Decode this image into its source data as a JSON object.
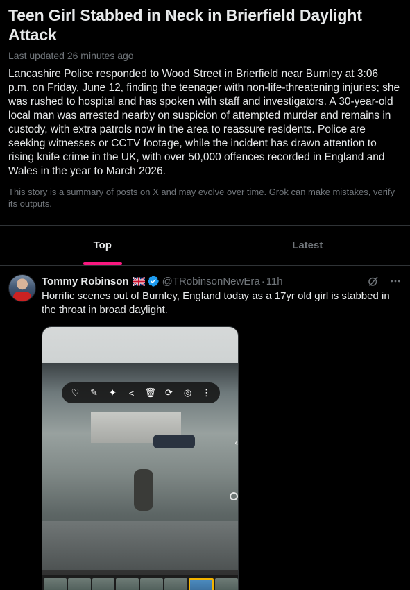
{
  "story": {
    "title": "Teen Girl Stabbed in Neck in Brierfield Daylight Attack",
    "updated": "Last updated 26 minutes ago",
    "summary": "Lancashire Police responded to Wood Street in Brierfield near Burnley at 3:06 p.m. on Friday, June 12, finding the teenager with non-life-threatening injuries; she was rushed to hospital and has spoken with staff and investigators. A 30-year-old local man was arrested nearby on suspicion of attempted murder and remains in custody, with extra patrols now in the area to reassure residents. Police are seeking witnesses or CCTV footage, while the incident has drawn attention to rising knife crime in the UK, with over 50,000 offences recorded in England and Wales in the year to March 2026.",
    "disclaimer": "This story is a summary of posts on X and may evolve over time. Grok can make mistakes, verify its outputs."
  },
  "tabs": [
    {
      "label": "Top",
      "active": true
    },
    {
      "label": "Latest",
      "active": false
    }
  ],
  "post": {
    "name": "Tommy Robinson",
    "handle": "@TRobinsonNewEra",
    "separator": "·",
    "time": "11h",
    "text": "Horrific scenes out of Burnley, England today as a 17yr old girl is stabbed in the throat in broad daylight.",
    "icons": {
      "flag": "uk-flag-icon",
      "verified": "verified-badge-icon",
      "grok": "grok-icon",
      "more": "more-icon"
    }
  },
  "colors": {
    "background": "#000000",
    "text": "#e7e9ea",
    "muted": "#71767b",
    "accent": "#f91880",
    "verified": "#1d9bf0",
    "divider": "#2f3336"
  }
}
